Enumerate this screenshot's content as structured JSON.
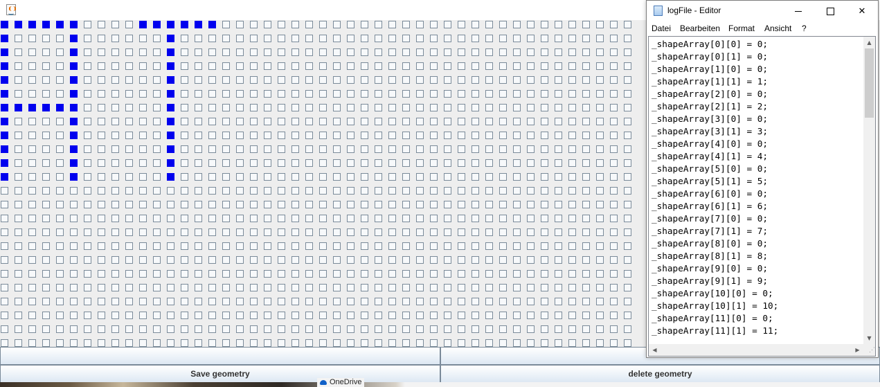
{
  "java_window": {
    "icon": "java-coffee-cup-icon",
    "grid": {
      "columns": 46,
      "rows": 24,
      "on_color": "#0000ee",
      "off_color": "#f7f9fb",
      "filled_cells": [
        [
          0,
          0
        ],
        [
          0,
          1
        ],
        [
          0,
          2
        ],
        [
          0,
          3
        ],
        [
          0,
          4
        ],
        [
          0,
          5
        ],
        [
          0,
          10
        ],
        [
          0,
          11
        ],
        [
          0,
          12
        ],
        [
          0,
          13
        ],
        [
          0,
          14
        ],
        [
          0,
          15
        ],
        [
          1,
          0
        ],
        [
          1,
          5
        ],
        [
          1,
          12
        ],
        [
          2,
          0
        ],
        [
          2,
          5
        ],
        [
          2,
          12
        ],
        [
          3,
          0
        ],
        [
          3,
          5
        ],
        [
          3,
          12
        ],
        [
          4,
          0
        ],
        [
          4,
          5
        ],
        [
          4,
          12
        ],
        [
          5,
          0
        ],
        [
          5,
          5
        ],
        [
          5,
          12
        ],
        [
          6,
          0
        ],
        [
          6,
          1
        ],
        [
          6,
          2
        ],
        [
          6,
          3
        ],
        [
          6,
          4
        ],
        [
          6,
          5
        ],
        [
          6,
          12
        ],
        [
          7,
          0
        ],
        [
          7,
          5
        ],
        [
          7,
          12
        ],
        [
          8,
          0
        ],
        [
          8,
          5
        ],
        [
          8,
          12
        ],
        [
          9,
          0
        ],
        [
          9,
          5
        ],
        [
          9,
          12
        ],
        [
          10,
          0
        ],
        [
          10,
          5
        ],
        [
          10,
          12
        ],
        [
          11,
          0
        ],
        [
          11,
          5
        ],
        [
          11,
          12
        ]
      ]
    },
    "buttons": {
      "empty_left": "",
      "empty_right": "",
      "save": "Save geometry",
      "delete": "delete geometry"
    }
  },
  "taskbar_peek": {
    "onedrive_label": "OneDrive"
  },
  "notepad": {
    "icon": "notepad-icon",
    "title": "logFile - Editor",
    "controls": {
      "minimize": "minimize-icon",
      "maximize": "maximize-icon",
      "close": "✕"
    },
    "menu": [
      "Datei",
      "Bearbeiten",
      "Format",
      "Ansicht",
      "?"
    ],
    "content": "_shapeArray[0][0] = 0;\n_shapeArray[0][1] = 0;\n_shapeArray[1][0] = 0;\n_shapeArray[1][1] = 1;\n_shapeArray[2][0] = 0;\n_shapeArray[2][1] = 2;\n_shapeArray[3][0] = 0;\n_shapeArray[3][1] = 3;\n_shapeArray[4][0] = 0;\n_shapeArray[4][1] = 4;\n_shapeArray[5][0] = 0;\n_shapeArray[5][1] = 5;\n_shapeArray[6][0] = 0;\n_shapeArray[6][1] = 6;\n_shapeArray[7][0] = 0;\n_shapeArray[7][1] = 7;\n_shapeArray[8][0] = 0;\n_shapeArray[8][1] = 8;\n_shapeArray[9][0] = 0;\n_shapeArray[9][1] = 9;\n_shapeArray[10][0] = 0;\n_shapeArray[10][1] = 10;\n_shapeArray[11][0] = 0;\n_shapeArray[11][1] = 11;"
  }
}
